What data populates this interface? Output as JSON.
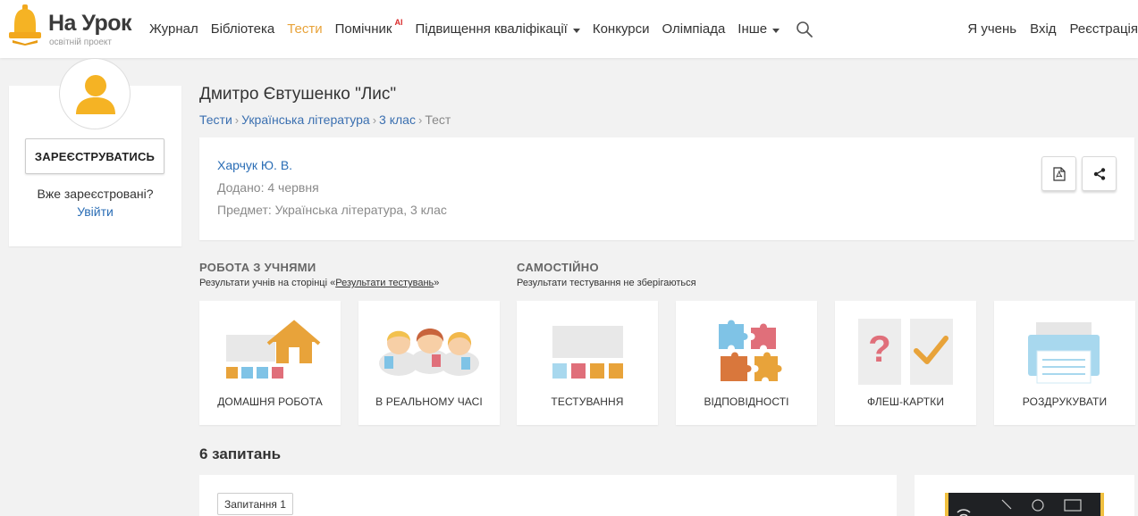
{
  "header": {
    "logo_title": "На Урок",
    "logo_subtitle": "освітній проект",
    "nav": [
      {
        "label": "Журнал"
      },
      {
        "label": "Бібліотека"
      },
      {
        "label": "Тести",
        "active": true
      },
      {
        "label": "Помічник",
        "badge": "AI"
      },
      {
        "label": "Підвищення кваліфікації",
        "dropdown": true
      },
      {
        "label": "Конкурси"
      },
      {
        "label": "Олімпіада"
      },
      {
        "label": "Інше",
        "dropdown": true
      }
    ],
    "right_nav": [
      "Я учень",
      "Вхід",
      "Реєстрація"
    ],
    "search_icon": "search-icon"
  },
  "sidebar": {
    "register_label": "ЗАРЕЄСТРУВАТИСЬ",
    "already_text": "Вже зареєстровані?",
    "login_label": "Увійти"
  },
  "page": {
    "title": "Дмитро Євтушенко \"Лис\"",
    "breadcrumbs": [
      "Тести",
      "Українська література",
      "3 клас",
      "Тест"
    ]
  },
  "info": {
    "author": "Харчук Ю. В.",
    "added": "Додано: 4 червня",
    "subject": "Предмет: Українська література, 3 клас",
    "pdf_icon": "pdf-icon",
    "share_icon": "share-icon"
  },
  "sections": {
    "students": {
      "title": "РОБОТА З УЧНЯМИ",
      "sub_prefix": "Результати учнів на сторінці «",
      "sub_link": "Результати тестувань",
      "sub_suffix": "»"
    },
    "self": {
      "title": "САМОСТІЙНО",
      "sub": "Результати тестування не зберігаються"
    }
  },
  "tiles": [
    {
      "label": "ДОМАШНЯ РОБОТА",
      "icon": "homework-icon"
    },
    {
      "label": "В РЕАЛЬНОМУ ЧАСІ",
      "icon": "realtime-icon"
    },
    {
      "label": "ТЕСТУВАННЯ",
      "icon": "testing-icon"
    },
    {
      "label": "ВІДПОВІДНОСТІ",
      "icon": "puzzle-icon"
    },
    {
      "label": "ФЛЕШ-КАРТКИ",
      "icon": "flashcards-icon"
    },
    {
      "label": "РОЗДРУКУВАТИ",
      "icon": "printer-icon"
    }
  ],
  "questions": {
    "count_label": "6 запитань",
    "first_tag": "Запитання 1"
  },
  "colors": {
    "accent": "#e8a33a",
    "link": "#2a6db5",
    "background": "#f2f2f2"
  }
}
